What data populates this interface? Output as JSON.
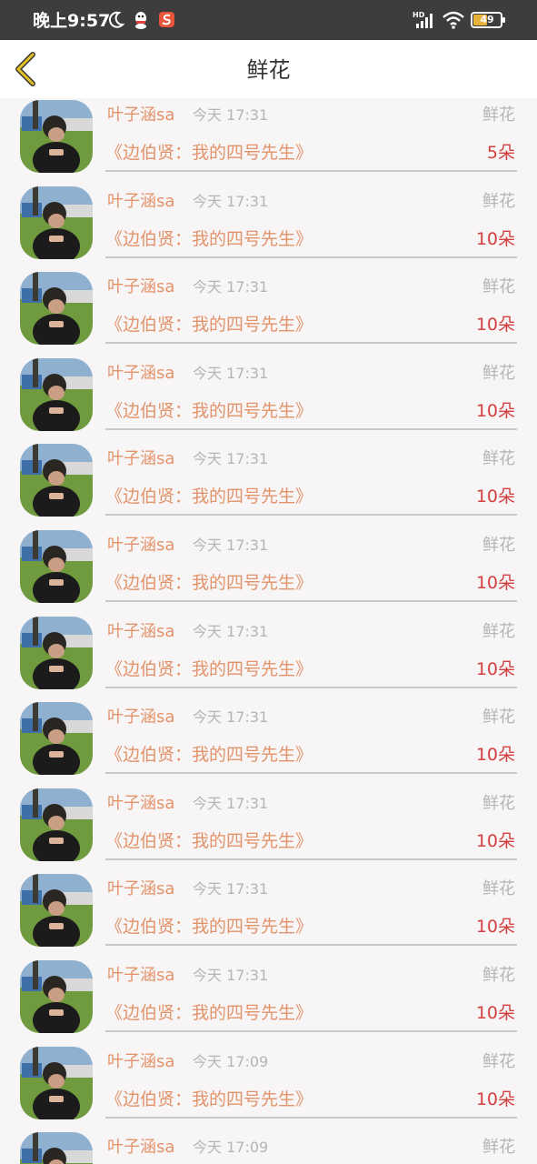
{
  "status_bar": {
    "time": "晚上9:57",
    "battery": "49",
    "network": "HD"
  },
  "header": {
    "title": "鲜花",
    "back_icon": "chevron-left-icon"
  },
  "colors": {
    "name": "#e3936a",
    "count": "#d43f3f",
    "meta": "#b5b5b5",
    "back_icon": "#e0c020"
  },
  "records": [
    {
      "user": "叶子涵sa",
      "time": "今天 17:31",
      "gift": "鲜花",
      "book": "《边伯贤：我的四号先生》",
      "count": "5朵"
    },
    {
      "user": "叶子涵sa",
      "time": "今天 17:31",
      "gift": "鲜花",
      "book": "《边伯贤：我的四号先生》",
      "count": "10朵"
    },
    {
      "user": "叶子涵sa",
      "time": "今天 17:31",
      "gift": "鲜花",
      "book": "《边伯贤：我的四号先生》",
      "count": "10朵"
    },
    {
      "user": "叶子涵sa",
      "time": "今天 17:31",
      "gift": "鲜花",
      "book": "《边伯贤：我的四号先生》",
      "count": "10朵"
    },
    {
      "user": "叶子涵sa",
      "time": "今天 17:31",
      "gift": "鲜花",
      "book": "《边伯贤：我的四号先生》",
      "count": "10朵"
    },
    {
      "user": "叶子涵sa",
      "time": "今天 17:31",
      "gift": "鲜花",
      "book": "《边伯贤：我的四号先生》",
      "count": "10朵"
    },
    {
      "user": "叶子涵sa",
      "time": "今天 17:31",
      "gift": "鲜花",
      "book": "《边伯贤：我的四号先生》",
      "count": "10朵"
    },
    {
      "user": "叶子涵sa",
      "time": "今天 17:31",
      "gift": "鲜花",
      "book": "《边伯贤：我的四号先生》",
      "count": "10朵"
    },
    {
      "user": "叶子涵sa",
      "time": "今天 17:31",
      "gift": "鲜花",
      "book": "《边伯贤：我的四号先生》",
      "count": "10朵"
    },
    {
      "user": "叶子涵sa",
      "time": "今天 17:31",
      "gift": "鲜花",
      "book": "《边伯贤：我的四号先生》",
      "count": "10朵"
    },
    {
      "user": "叶子涵sa",
      "time": "今天 17:31",
      "gift": "鲜花",
      "book": "《边伯贤：我的四号先生》",
      "count": "10朵"
    },
    {
      "user": "叶子涵sa",
      "time": "今天 17:09",
      "gift": "鲜花",
      "book": "《边伯贤：我的四号先生》",
      "count": "10朵"
    },
    {
      "user": "叶子涵sa",
      "time": "今天 17:09",
      "gift": "鲜花",
      "book": "",
      "count": ""
    }
  ]
}
